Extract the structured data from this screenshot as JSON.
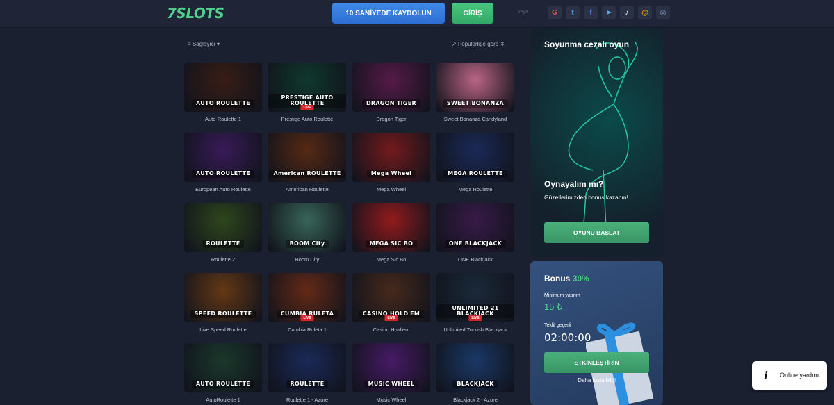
{
  "header": {
    "logo": "7SLOTS",
    "register_label": "10 SANİYEDE KAYDOLUN",
    "login_label": "GİRİŞ",
    "or_text": "veya",
    "social_icons": [
      "google-icon",
      "twitter-icon",
      "facebook-icon",
      "telegram-icon",
      "tiktok-icon",
      "mailru-icon",
      "steam-icon"
    ]
  },
  "toolbar": {
    "filter_label": "Sağlayıcı",
    "sort_label": "Popülerliğe göre"
  },
  "games": [
    {
      "name": "Auto-Roulette 1",
      "thumb": "AUTO ROULETTE",
      "live": false,
      "bg": "#3a1d12"
    },
    {
      "name": "Prestige Auto Roulette",
      "thumb": "PRESTIGE AUTO ROULETTE",
      "live": true,
      "bg": "#0f3a2c"
    },
    {
      "name": "Dragon Tiger",
      "thumb": "DRAGON TIGER",
      "live": false,
      "bg": "#5a1a4a"
    },
    {
      "name": "Sweet Bonanza Candyland",
      "thumb": "SWEET BONANZA",
      "live": false,
      "bg": "#c66a8a"
    },
    {
      "name": "European Auto Roulette",
      "thumb": "AUTO ROULETTE",
      "live": false,
      "bg": "#3a1a5a"
    },
    {
      "name": "American Roulette",
      "thumb": "American ROULETTE",
      "live": false,
      "bg": "#5a2a12"
    },
    {
      "name": "Mega Wheel",
      "thumb": "Mega Wheel",
      "live": false,
      "bg": "#7a1a1a"
    },
    {
      "name": "Mega Roulette",
      "thumb": "MEGA ROULETTE",
      "live": false,
      "bg": "#1a2a5a"
    },
    {
      "name": "Roulette 2",
      "thumb": "ROULETTE",
      "live": false,
      "bg": "#2f4a1a"
    },
    {
      "name": "Boom City",
      "thumb": "BOOM City",
      "live": false,
      "bg": "#3a6a5a"
    },
    {
      "name": "Mega Sic Bo",
      "thumb": "MEGA SIC BO",
      "live": false,
      "bg": "#9a1a1a"
    },
    {
      "name": "ONE Blackjack",
      "thumb": "ONE BLACKJACK",
      "live": false,
      "bg": "#3a1a4a"
    },
    {
      "name": "Live Speed Roulette",
      "thumb": "SPEED ROULETTE",
      "live": false,
      "bg": "#6a3a12"
    },
    {
      "name": "Cumbia Ruleta 1",
      "thumb": "CUMBIA RULETA",
      "live": true,
      "bg": "#6a2a14"
    },
    {
      "name": "Casino Hold'em",
      "thumb": "CASINO HOLD'EM",
      "live": true,
      "bg": "#4a2a1a"
    },
    {
      "name": "Unlimited Turkish Blackjack",
      "thumb": "UNLIMITED 21 BLACKJACK",
      "live": true,
      "bg": "#1a2a3a"
    },
    {
      "name": "AutoRoulette 1",
      "thumb": "AUTO ROULETTE",
      "live": false,
      "bg": "#1a3a2a"
    },
    {
      "name": "Roulette 1 - Azure",
      "thumb": "ROULETTE",
      "live": false,
      "bg": "#1a2a5a"
    },
    {
      "name": "Music Wheel",
      "thumb": "MUSIC WHEEL",
      "live": false,
      "bg": "#4a1a6a"
    },
    {
      "name": "Blackjack 2 - Azure",
      "thumb": "BLACKJACK",
      "live": false,
      "bg": "#1a3a6a"
    }
  ],
  "live_badge": "LIVE",
  "promo": {
    "title": "Soyunma cezalı oyun",
    "question": "Oynayalım mı?",
    "subtitle": "Güzellerimizden bonus kazanın!",
    "button": "OYUNU BAŞLAT"
  },
  "bonus": {
    "title": "Bonus",
    "percent": "30%",
    "min_label": "Minimum yatırım",
    "min_value": "15 ₺",
    "valid_label": "Teklif geçerli",
    "valid_value": "02:00:00",
    "button": "ETKİNLEŞTİRİN",
    "link": "Daha fazla bilgi"
  },
  "help": {
    "icon": "i",
    "text": "Online yardım"
  },
  "colors": {
    "background": "#1b2030",
    "accent_green": "#4fd18b",
    "register_blue": "#3f8ae8"
  }
}
